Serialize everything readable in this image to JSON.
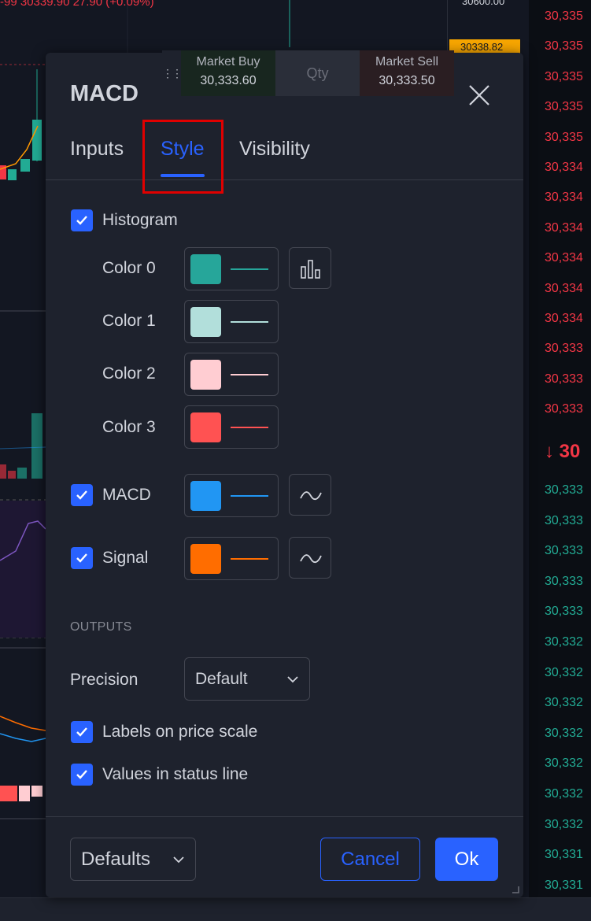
{
  "background": {
    "top_strip_text": "-99 30339.90 27.90 (+0.09%)",
    "price_scale_label": "30600.00",
    "current_price_label": "30338.82",
    "orderbook_asks": [
      "30,335",
      "30,335",
      "30,335",
      "30,335",
      "30,335",
      "30,334",
      "30,334",
      "30,334",
      "30,334",
      "30,334",
      "30,334",
      "30,333",
      "30,333",
      "30,333"
    ],
    "orderbook_mid": "↓ 30",
    "orderbook_bids": [
      "30,333",
      "30,333",
      "30,333",
      "30,333",
      "30,333",
      "30,332",
      "30,332",
      "30,332",
      "30,332",
      "30,332",
      "30,332",
      "30,332",
      "30,331",
      "30,331"
    ]
  },
  "trade_widget": {
    "buy_label": "Market Buy",
    "buy_price": "30,333.60",
    "qty_placeholder": "Qty",
    "sell_label": "Market Sell",
    "sell_price": "30,333.50"
  },
  "dialog": {
    "title": "MACD",
    "tabs": [
      {
        "label": "Inputs",
        "active": false
      },
      {
        "label": "Style",
        "active": true
      },
      {
        "label": "Visibility",
        "active": false
      }
    ],
    "histogram": {
      "label": "Histogram",
      "checked": true,
      "colors": [
        {
          "label": "Color 0",
          "swatch": "#26a69a"
        },
        {
          "label": "Color 1",
          "swatch": "#b2dfdb"
        },
        {
          "label": "Color 2",
          "swatch": "#ffcdd2"
        },
        {
          "label": "Color 3",
          "swatch": "#ff5252"
        }
      ]
    },
    "macd": {
      "label": "MACD",
      "checked": true,
      "color": "#2196f3"
    },
    "signal": {
      "label": "Signal",
      "checked": true,
      "color": "#ff6d00"
    },
    "outputs": {
      "header": "OUTPUTS",
      "precision_label": "Precision",
      "precision_value": "Default",
      "labels_on_price_scale": {
        "label": "Labels on price scale",
        "checked": true
      },
      "values_in_status_line": {
        "label": "Values in status line",
        "checked": true
      }
    },
    "footer": {
      "defaults_label": "Defaults",
      "cancel_label": "Cancel",
      "ok_label": "Ok"
    }
  },
  "colors": {
    "accent": "#2962ff",
    "highlight_box": "#e00000",
    "ask_red": "#f23645",
    "bid_green": "#22ab94"
  }
}
